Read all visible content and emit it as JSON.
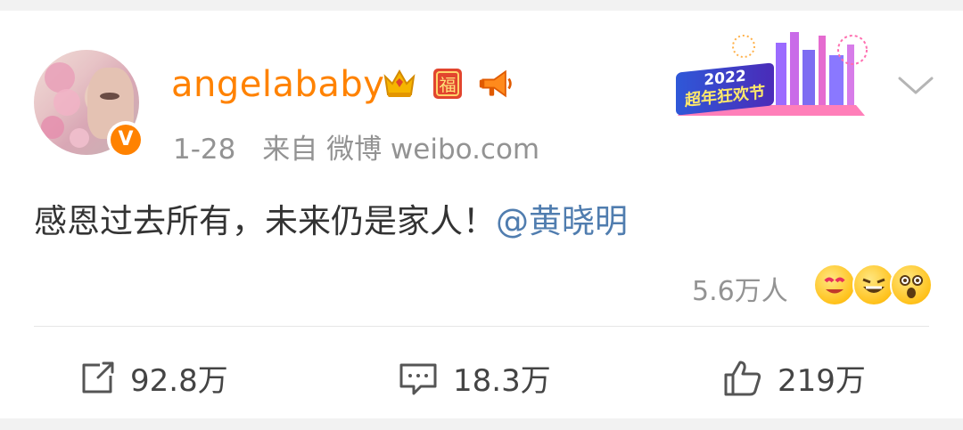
{
  "post": {
    "username": "angelababy",
    "date": "1-28",
    "source": "来自 微博 weibo.com",
    "text": "感恩过去所有，未来仍是家人！",
    "mention": "@黄晓明",
    "reaction_count": "5.6万人",
    "badges": [
      "crown-icon",
      "fu-icon",
      "megaphone-icon"
    ],
    "promo_banner": {
      "year": "2022",
      "title": "超年狂欢节"
    }
  },
  "actions": {
    "repost_count": "92.8万",
    "comment_count": "18.3万",
    "like_count": "219万"
  },
  "colors": {
    "username": "#ff8200",
    "mention": "#507daf",
    "meta": "#939393",
    "text": "#333333"
  }
}
